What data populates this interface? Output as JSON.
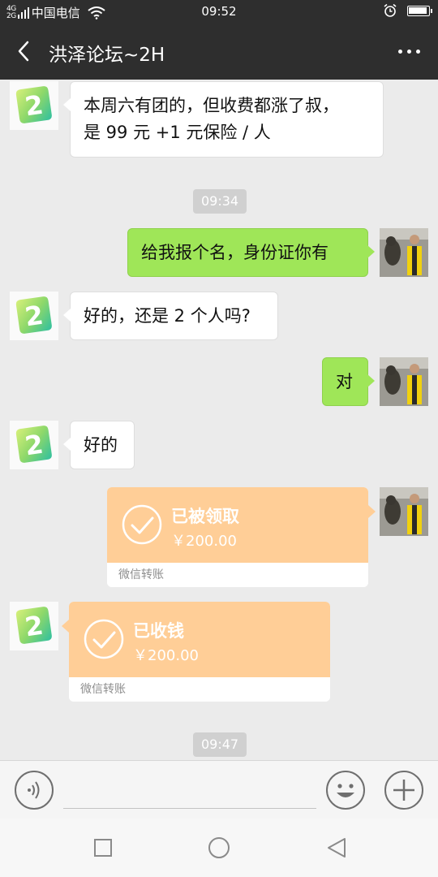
{
  "status_bar": {
    "signal_text": "4G",
    "signal_sub": "2G",
    "carrier": "中国电信",
    "time": "09:52",
    "battery_level": 0.95
  },
  "header": {
    "title": "洪泽论坛~2H"
  },
  "messages": [
    {
      "type": "text",
      "side": "left",
      "text_line1": "本周六有团的，但收费都涨了叔，",
      "text_line2": "是 99 元 +1 元保险 / 人"
    },
    {
      "type": "time",
      "text": "09:34"
    },
    {
      "type": "text",
      "side": "right",
      "text": "给我报个名，身份证你有"
    },
    {
      "type": "text",
      "side": "left",
      "text": "好的，还是 2 个人吗?"
    },
    {
      "type": "text",
      "side": "right",
      "text": "对"
    },
    {
      "type": "text",
      "side": "left",
      "text": "好的"
    },
    {
      "type": "transfer",
      "side": "right",
      "status": "已被领取",
      "amount": "￥200.00",
      "footer": "微信转账"
    },
    {
      "type": "transfer",
      "side": "left",
      "status": "已收钱",
      "amount": "￥200.00",
      "footer": "微信转账"
    },
    {
      "type": "time",
      "text": "09:47"
    }
  ],
  "colors": {
    "header_bg": "#2e2e2e",
    "chat_bg": "#ebebeb",
    "my_bubble": "#9fe658",
    "their_bubble": "#ffffff",
    "transfer": "#ffce97"
  },
  "icons": {
    "status": [
      "signal-icon",
      "wifi-icon",
      "alarm-icon",
      "battery-icon"
    ],
    "header": [
      "back-arrow-icon",
      "more-icon"
    ],
    "input": [
      "voice-icon",
      "emoji-icon",
      "plus-icon"
    ],
    "nav": [
      "recent-apps-icon",
      "home-icon",
      "back-icon"
    ]
  }
}
